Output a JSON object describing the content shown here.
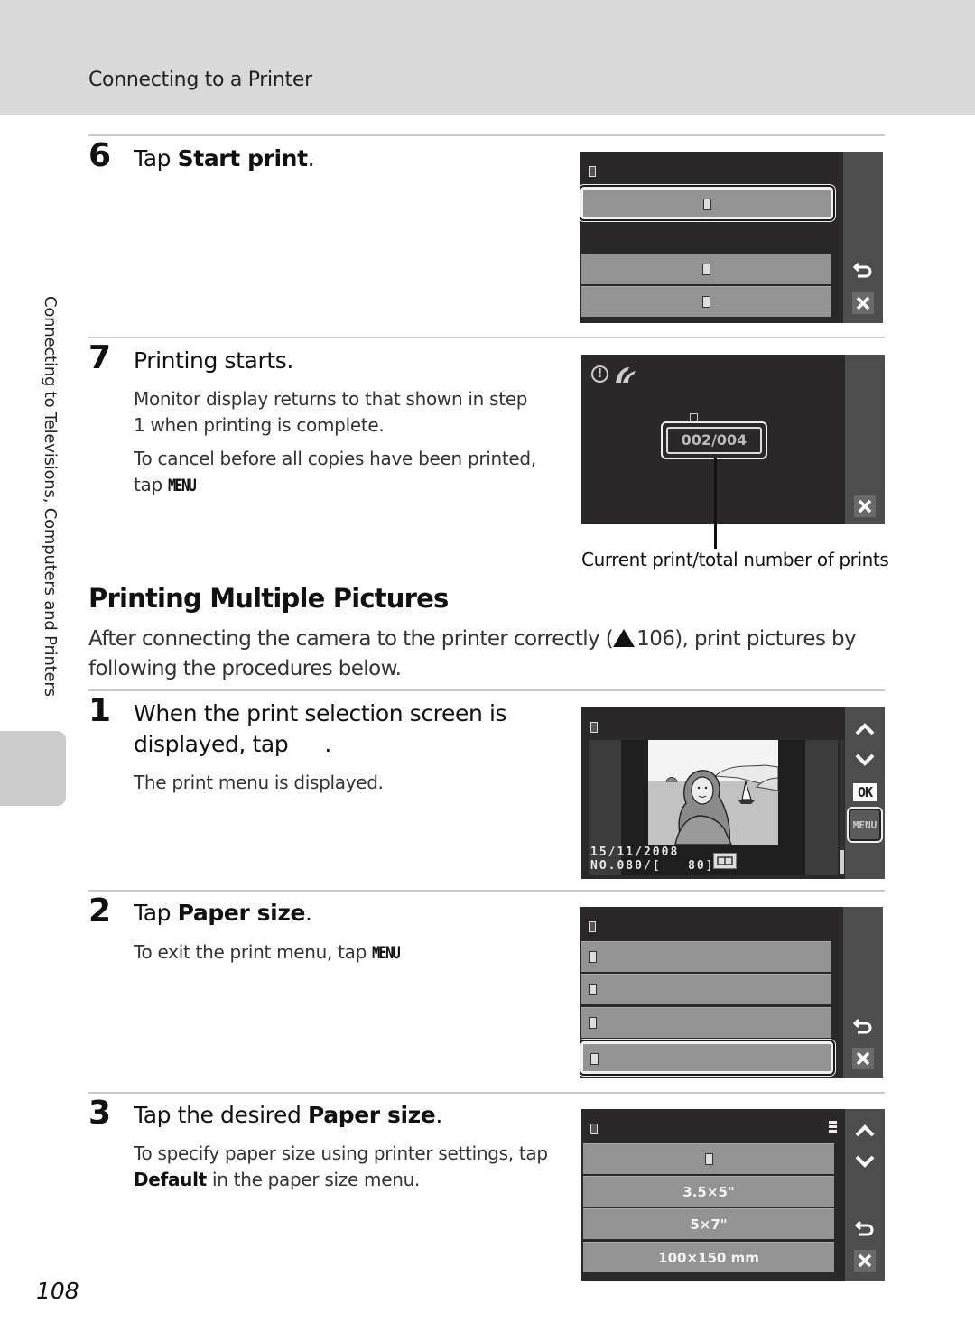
{
  "header": {
    "title": "Connecting to a Printer"
  },
  "side_label": "Connecting to Televisions, Computers and Printers",
  "page_number": "108",
  "steps_top": [
    {
      "number": "6",
      "title_prefix": "Tap ",
      "title_bold": "Start print",
      "title_suffix": ".",
      "screen": {
        "title_glyph": "▯",
        "rows": [
          {
            "label": "▯",
            "selected": true
          },
          {
            "label": "▯",
            "selected": false
          },
          {
            "label": "▯",
            "selected": false
          }
        ],
        "icons": [
          "back-icon",
          "close-icon"
        ]
      }
    },
    {
      "number": "7",
      "title": "Printing starts.",
      "paragraphs": [
        "Monitor display returns to that shown in step 1 when printing is complete.",
        "To cancel before all copies have been printed, tap"
      ],
      "menu_symbol": "MENU",
      "screen": {
        "status_icons": [
          "warning-icon",
          "printing-icon"
        ],
        "counter_label": "▯",
        "counter": "002/004",
        "current_print": 2,
        "total_prints": 4,
        "icons": [
          "close-icon"
        ]
      },
      "caption": "Current print/total number of prints"
    }
  ],
  "section": {
    "title": "Printing Multiple Pictures",
    "intro_before": "After connecting the camera to the printer correctly (",
    "intro_ref": "106",
    "intro_after": "), print pictures by following the procedures below."
  },
  "steps_bottom": [
    {
      "number": "1",
      "title_line1": "When the print selection screen is",
      "title_line2": "displayed, tap",
      "title_suffix": ".",
      "note": "The print menu is displayed.",
      "screen": {
        "title_glyph": "▯",
        "date": "15/11/2008",
        "file_info": "NO.080/[   80]",
        "buttons": [
          "up-arrow-icon",
          "down-arrow-icon",
          "OK",
          "MENU"
        ],
        "scroll_position": 0.85
      }
    },
    {
      "number": "2",
      "title_prefix": "Tap ",
      "title_bold": "Paper size",
      "title_suffix": ".",
      "note": "To exit the print menu, tap",
      "menu_symbol": "MENU",
      "screen": {
        "title_glyph": "▯",
        "rows": [
          {
            "label": "▯",
            "selected": false
          },
          {
            "label": "▯",
            "selected": false
          },
          {
            "label": "▯",
            "selected": false
          },
          {
            "label": "▯",
            "selected": true
          }
        ],
        "icons": [
          "back-icon",
          "close-icon"
        ]
      }
    },
    {
      "number": "3",
      "title_prefix": "Tap the desired ",
      "title_bold": "Paper size",
      "title_suffix": ".",
      "note_prefix": "To specify paper size using printer settings, tap ",
      "note_bold": "Default",
      "note_suffix": " in the paper size menu.",
      "screen": {
        "title_glyph": "▯",
        "rows": [
          {
            "label": "▯"
          },
          {
            "label": "3.5×5\""
          },
          {
            "label": "5×7\""
          },
          {
            "label": "100×150 mm"
          }
        ],
        "icons": [
          "up-arrow-icon",
          "down-arrow-icon",
          "back-icon",
          "close-icon"
        ]
      }
    }
  ]
}
